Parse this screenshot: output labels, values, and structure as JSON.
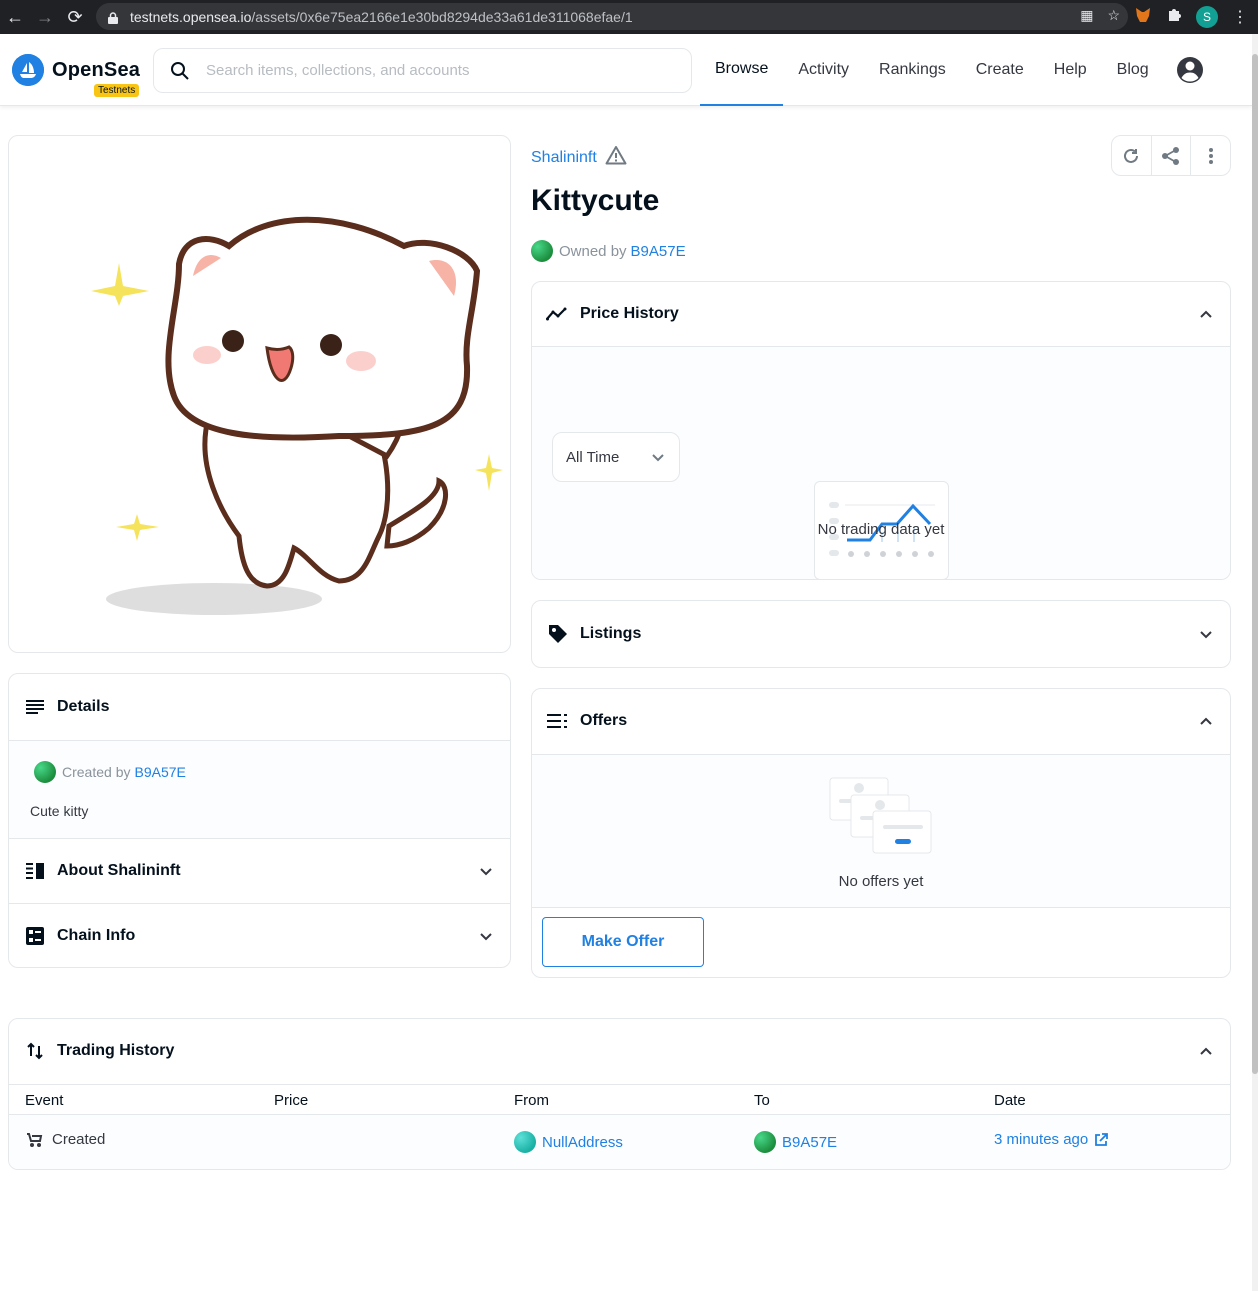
{
  "browser": {
    "url_host": "testnets.opensea.io",
    "url_path": "/assets/0x6e75ea2166e1e30bd8294de33a61de311068efae/1",
    "profile_initial": "S"
  },
  "header": {
    "logo_text": "OpenSea",
    "badge": "Testnets",
    "search_placeholder": "Search items, collections, and accounts",
    "nav": [
      "Browse",
      "Activity",
      "Rankings",
      "Create",
      "Help",
      "Blog"
    ]
  },
  "asset": {
    "collection": "Shalininft",
    "title": "Kittycute",
    "owned_by_label": "Owned by",
    "owner": "B9A57E"
  },
  "price_history": {
    "title": "Price History",
    "range": "All Time",
    "empty": "No trading data yet"
  },
  "listings": {
    "title": "Listings"
  },
  "offers": {
    "title": "Offers",
    "empty": "No offers yet",
    "button": "Make Offer"
  },
  "details": {
    "title": "Details",
    "created_by_label": "Created by",
    "creator": "B9A57E",
    "description": "Cute kitty"
  },
  "about": {
    "title": "About Shalininft"
  },
  "chain_info": {
    "title": "Chain Info"
  },
  "trading_history": {
    "title": "Trading History",
    "columns": [
      "Event",
      "Price",
      "From",
      "To",
      "Date"
    ],
    "rows": [
      {
        "event": "Created",
        "price": "",
        "from": "NullAddress",
        "to": "B9A57E",
        "date": "3 minutes ago"
      }
    ]
  },
  "colors": {
    "accent": "#2081e2",
    "badge": "#f9c515",
    "text": "#04111d"
  }
}
